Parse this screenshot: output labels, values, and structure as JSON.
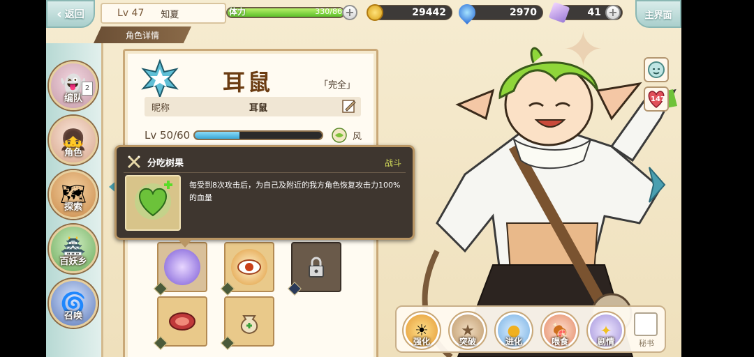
{
  "header": {
    "back_label": "返回",
    "level": "Lv 47",
    "player_name": "知夏",
    "sub_tab": "角色详情",
    "stamina_label": "体力",
    "stamina_value": "330/86",
    "stamina_fill": 1.0,
    "gold": "29442",
    "gems": "2970",
    "crystals": "41",
    "home_label": "主界面"
  },
  "sidebar": {
    "items": [
      {
        "label": "编队",
        "badge": "2"
      },
      {
        "label": "角色"
      },
      {
        "label": "探索"
      },
      {
        "label": "百妖乡"
      },
      {
        "label": "召唤"
      }
    ]
  },
  "character": {
    "name": "耳鼠",
    "state": "「完全」",
    "nickname_label": "昵称",
    "nickname": "耳鼠",
    "level": "Lv 50/60",
    "xp_fill": 0.35,
    "element": "风"
  },
  "tooltip": {
    "title": "分吃树果",
    "type": "战斗",
    "description": "每受到8次攻击后，为自己及附近的我方角色恢复攻击力100%的血量"
  },
  "right": {
    "hearts": "147"
  },
  "actions": [
    {
      "label": "强化"
    },
    {
      "label": "突破"
    },
    {
      "label": "进化"
    },
    {
      "label": "喂食"
    },
    {
      "label": "剧情"
    }
  ],
  "secret_label": "秘书",
  "colors": {
    "accent_teal": "#4a9fb0",
    "brown_title": "#6b3c12",
    "wind_green": "#5cbf2a"
  }
}
